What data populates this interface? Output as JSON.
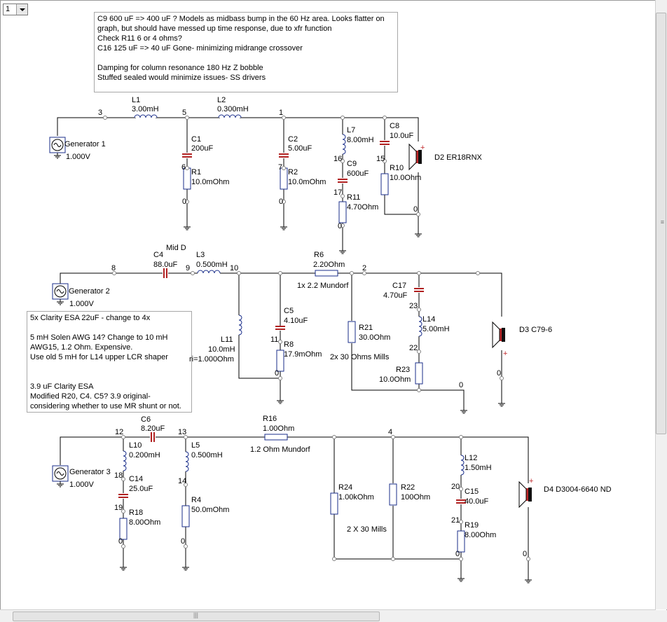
{
  "toolbar": {
    "page_select_value": "1"
  },
  "notes": {
    "note1": "C9  600 uF => 400 uF  ?  Models as midbass bump in the 60 Hz area.  Looks flatter on\ngraph, but should have messed up time response, due to xfr function\nCheck R11  6 or 4 ohms?\nC16  125 uF => 40 uF  Gone- minimizing midrange crossover\n\nDamping for column resonance 180 Hz Z bobble\nStuffed sealed would minimize issues- SS drivers",
    "note2": "5x Clarity ESA 22uF - change to 4x\n\n5 mH Solen AWG 14? Change to 10 mH\nAWG15, 1.2 Ohm.  Expensive.\nUse old 5 mH for L14 upper LCR shaper\n\n\n3.9 uF Clarity ESA\nModified R20, C4. C5?  3.9 original-\nconsidering whether to use MR shunt or not."
  },
  "labels": {
    "gen1": "Generator 1",
    "gen1_v": "1.000V",
    "gen2": "Generator 2",
    "gen2_v": "1.000V",
    "gen3": "Generator 3",
    "gen3_v": "1.000V",
    "L1": "L1",
    "L1_v": "3.00mH",
    "L2": "L2",
    "L2_v": "0.300mH",
    "C1": "C1",
    "C1_v": "200uF",
    "R1": "R1",
    "R1_v": "10.0mOhm",
    "C2": "C2",
    "C2_v": "5.00uF",
    "R2": "R2",
    "R2_v": "10.0mOhm",
    "L7": "L7",
    "L7_v": "8.00mH",
    "C9": "C9",
    "C9_v": "600uF",
    "R11": "R11",
    "R11_v": "4.70Ohm",
    "C8": "C8",
    "C8_v": "10.0uF",
    "R10": "R10",
    "R10_v": "10.0Ohm",
    "D2": "D2  ER18RNX",
    "C4": "C4",
    "C4_v": "88.0uF",
    "midD": "Mid D",
    "L3": "L3",
    "L3_v": "0.500mH",
    "R6": "R6",
    "R6_v": "2.20Ohm",
    "R6_note": "1x 2.2 Mundorf",
    "C5": "C5",
    "C5_v": "4.10uF",
    "R8": "R8",
    "R8_v": "17.9mOhm",
    "L11": "L11",
    "L11_v": "10.0mH",
    "L11_r": "ri=1.000Ohm",
    "R21": "R21",
    "R21_v": "30.0Ohm",
    "R21_note": "2x 30 Ohms Mills",
    "C17": "C17",
    "C17_v": "4.70uF",
    "L14": "L14",
    "L14_v": "5.00mH",
    "R23": "R23",
    "R23_v": "10.0Ohm",
    "D3": "D3 C79-6",
    "C6": "C6",
    "C6_v": "8.20uF",
    "L10": "L10",
    "L10_v": "0.200mH",
    "C14": "C14",
    "C14_v": "25.0uF",
    "R18": "R18",
    "R18_v": "8.00Ohm",
    "L5": "L5",
    "L5_v": "0.500mH",
    "R4": "R4",
    "R4_v": "50.0mOhm",
    "R16": "R16",
    "R16_v": "1.00Ohm",
    "R16_note": "1.2 Ohm Mundorf",
    "R24": "R24",
    "R24_v": "1.00kOhm",
    "R22": "R22",
    "R22_v": "100Ohm",
    "R22_note": "2 X 30 Mills",
    "L12": "L12",
    "L12_v": "1.50mH",
    "C15": "C15",
    "C15_v": "40.0uF",
    "R19": "R19",
    "R19_v": "8.00Ohm",
    "D4": "D4 D3004-6640 ND"
  },
  "nodes": {
    "n3": "3",
    "n5": "5",
    "n1": "1",
    "n6": "6",
    "n7": "7",
    "n16": "16",
    "n17": "17",
    "n15": "15",
    "n0a": "0",
    "n0b": "0",
    "n0c": "0",
    "n0d": "0",
    "n8": "8",
    "n9": "9",
    "n10": "10",
    "n2": "2",
    "n11": "11",
    "n23": "23",
    "n22": "22",
    "n0e": "0",
    "n0f": "0",
    "n0g": "0",
    "n12": "12",
    "n13": "13",
    "n4": "4",
    "n18": "18",
    "n19": "19",
    "n14": "14",
    "n20": "20",
    "n21": "21",
    "n0h": "0",
    "n0i": "0",
    "n0j": "0",
    "n0k": "0"
  },
  "colors": {
    "wire": "#000000",
    "component": "#1a2e8a",
    "capacitor": "#b02020",
    "node": "#808080"
  }
}
